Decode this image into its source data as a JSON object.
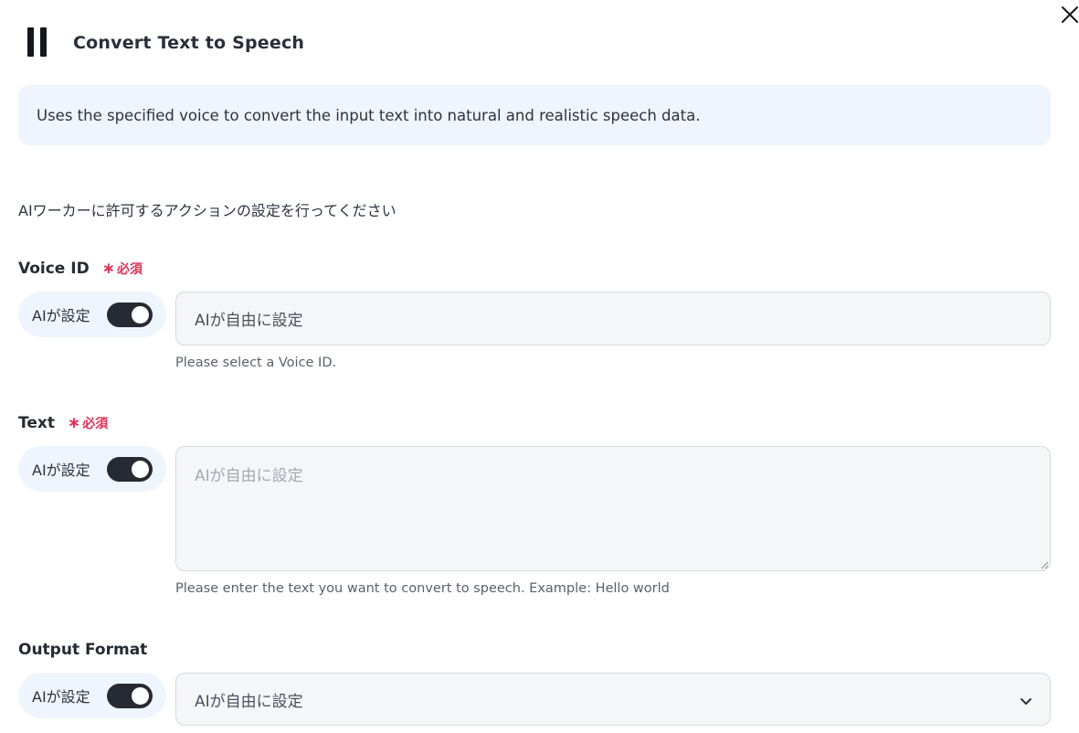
{
  "header": {
    "title": "Convert Text to Speech"
  },
  "description": "Uses the specified voice to convert the input text into natural and realistic speech data.",
  "instruction": "AIワーカーに許可するアクションの設定を行ってください",
  "required_label": "必須",
  "ai_toggle_label": "AIが設定",
  "fields": {
    "voice_id": {
      "label": "Voice ID",
      "value": "AIが自由に設定",
      "helper": "Please select a Voice ID."
    },
    "text": {
      "label": "Text",
      "placeholder": "AIが自由に設定",
      "helper": "Please enter the text you want to convert to speech. Example: Hello world"
    },
    "output_format": {
      "label": "Output Format",
      "value": "AIが自由に設定"
    }
  },
  "icons": {
    "close": "close-icon",
    "logo": "pause-logo-icon",
    "chevron": "chevron-down-icon"
  },
  "colors": {
    "accent_bg": "#eef5fd",
    "toggle_on": "#252a33",
    "required": "#e0325b"
  }
}
